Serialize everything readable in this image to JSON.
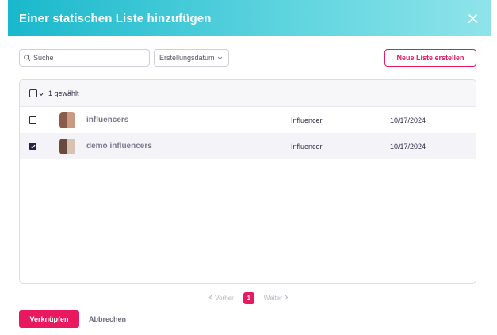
{
  "dialog": {
    "title": "Einer statischen Liste hinzufügen",
    "close_icon": "close-icon"
  },
  "toolbar": {
    "search_placeholder": "Suche",
    "search_value": "",
    "sort_label": "Erstellungsdatum",
    "new_list_label": "Neue Liste erstellen"
  },
  "table": {
    "selected_count_label": "1 gewählt",
    "rows": [
      {
        "name": "influencers",
        "type": "Influencer",
        "date": "10/17/2024",
        "checked": false,
        "avatar_colors": [
          "#8a5a4a",
          "#c99a82"
        ]
      },
      {
        "name": "demo influencers",
        "type": "Influencer",
        "date": "10/17/2024",
        "checked": true,
        "avatar_colors": [
          "#6b4a3e",
          "#d8c2b3"
        ]
      }
    ]
  },
  "pagination": {
    "prev_label": "Vorher",
    "current_page": "1",
    "next_label": "Weiter"
  },
  "footer": {
    "link_label": "Verknüpfen",
    "cancel_label": "Abbrechen"
  },
  "colors": {
    "accent": "#e8195e",
    "header_start": "#19b8cc",
    "header_end": "#8fe4ea",
    "checkbox_checked": "#2c2040"
  }
}
